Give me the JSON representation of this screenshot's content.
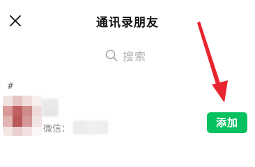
{
  "header": {
    "title": "通讯录朋友",
    "close_icon": "close-icon"
  },
  "search": {
    "placeholder": "搜索",
    "icon": "search-icon"
  },
  "contacts": {
    "section_label": "#",
    "items": [
      {
        "wechat_id_label": "微信：",
        "action_label": "添加"
      }
    ]
  },
  "colors": {
    "accent": "#07c160",
    "annotation": "#e8242e",
    "placeholder": "#b2b2b2"
  }
}
